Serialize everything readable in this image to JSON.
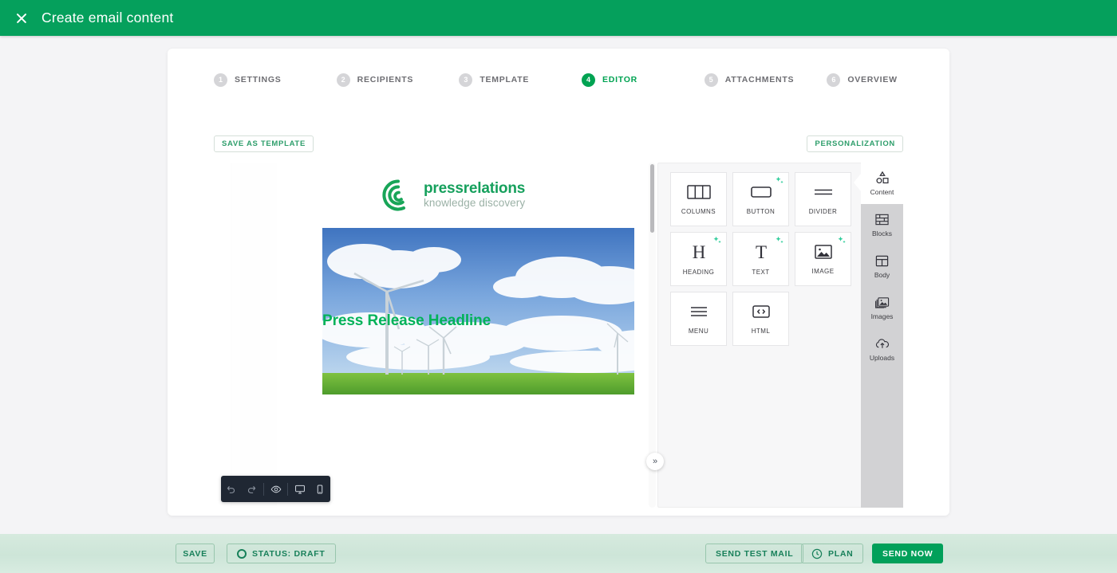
{
  "header": {
    "title": "Create email content",
    "close_icon": "close-icon",
    "brand_color": "#05a05c"
  },
  "stepper": {
    "steps": [
      {
        "num": "1",
        "label": "SETTINGS",
        "active": false
      },
      {
        "num": "2",
        "label": "RECIPIENTS",
        "active": false
      },
      {
        "num": "3",
        "label": "TEMPLATE",
        "active": false
      },
      {
        "num": "4",
        "label": "EDITOR",
        "active": true
      },
      {
        "num": "5",
        "label": "ATTACHMENTS",
        "active": false
      },
      {
        "num": "6",
        "label": "OVERVIEW",
        "active": false
      }
    ],
    "active_color": "#00a352",
    "inactive_color": "#d5d5d8"
  },
  "toolbar": {
    "save_as_template_label": "SAVE AS TEMPLATE",
    "personalization_label": "PERSONALIZATION"
  },
  "email_preview": {
    "logo_primary": "pressrelations",
    "logo_secondary": "knowledge discovery",
    "logo_color": "#15a05c",
    "hero_image_alt": "wind-turbines-in-green-field",
    "headline": "Press Release Headline",
    "headline_color": "#00b259"
  },
  "float_toolbar": {
    "buttons": [
      {
        "name": "undo-icon",
        "title": "Undo"
      },
      {
        "name": "redo-icon",
        "title": "Redo"
      },
      {
        "name": "preview-eye-icon",
        "title": "Preview"
      },
      {
        "name": "desktop-icon",
        "title": "Desktop view"
      },
      {
        "name": "mobile-icon",
        "title": "Mobile view"
      }
    ]
  },
  "collapse_button": {
    "glyph": "»"
  },
  "content_panel": {
    "blocks": [
      {
        "label": "COLUMNS",
        "icon": "columns-icon",
        "ai": false
      },
      {
        "label": "BUTTON",
        "icon": "button-icon",
        "ai": true
      },
      {
        "label": "DIVIDER",
        "icon": "divider-icon",
        "ai": false
      },
      {
        "label": "HEADING",
        "icon": "heading-icon",
        "ai": true
      },
      {
        "label": "TEXT",
        "icon": "text-icon",
        "ai": true
      },
      {
        "label": "IMAGE",
        "icon": "image-icon",
        "ai": true
      },
      {
        "label": "MENU",
        "icon": "menu-icon",
        "ai": false
      },
      {
        "label": "HTML",
        "icon": "html-icon",
        "ai": false
      }
    ],
    "sparkle_color": "#2ecc9a"
  },
  "sidebar_tabs": [
    {
      "label": "Content",
      "icon": "content-shapes-icon",
      "active": true
    },
    {
      "label": "Blocks",
      "icon": "bricks-icon",
      "active": false
    },
    {
      "label": "Body",
      "icon": "body-layout-icon",
      "active": false
    },
    {
      "label": "Images",
      "icon": "images-stack-icon",
      "active": false
    },
    {
      "label": "Uploads",
      "icon": "upload-cloud-icon",
      "active": false
    }
  ],
  "bottom_bar": {
    "save_label": "SAVE",
    "status_label": "STATUS: DRAFT",
    "status_icon": "circle-icon",
    "send_test_label": "SEND TEST MAIL",
    "plan_label": "PLAN",
    "plan_icon": "clock-icon",
    "send_now_label": "SEND NOW",
    "send_now_color": "#01a05a"
  }
}
